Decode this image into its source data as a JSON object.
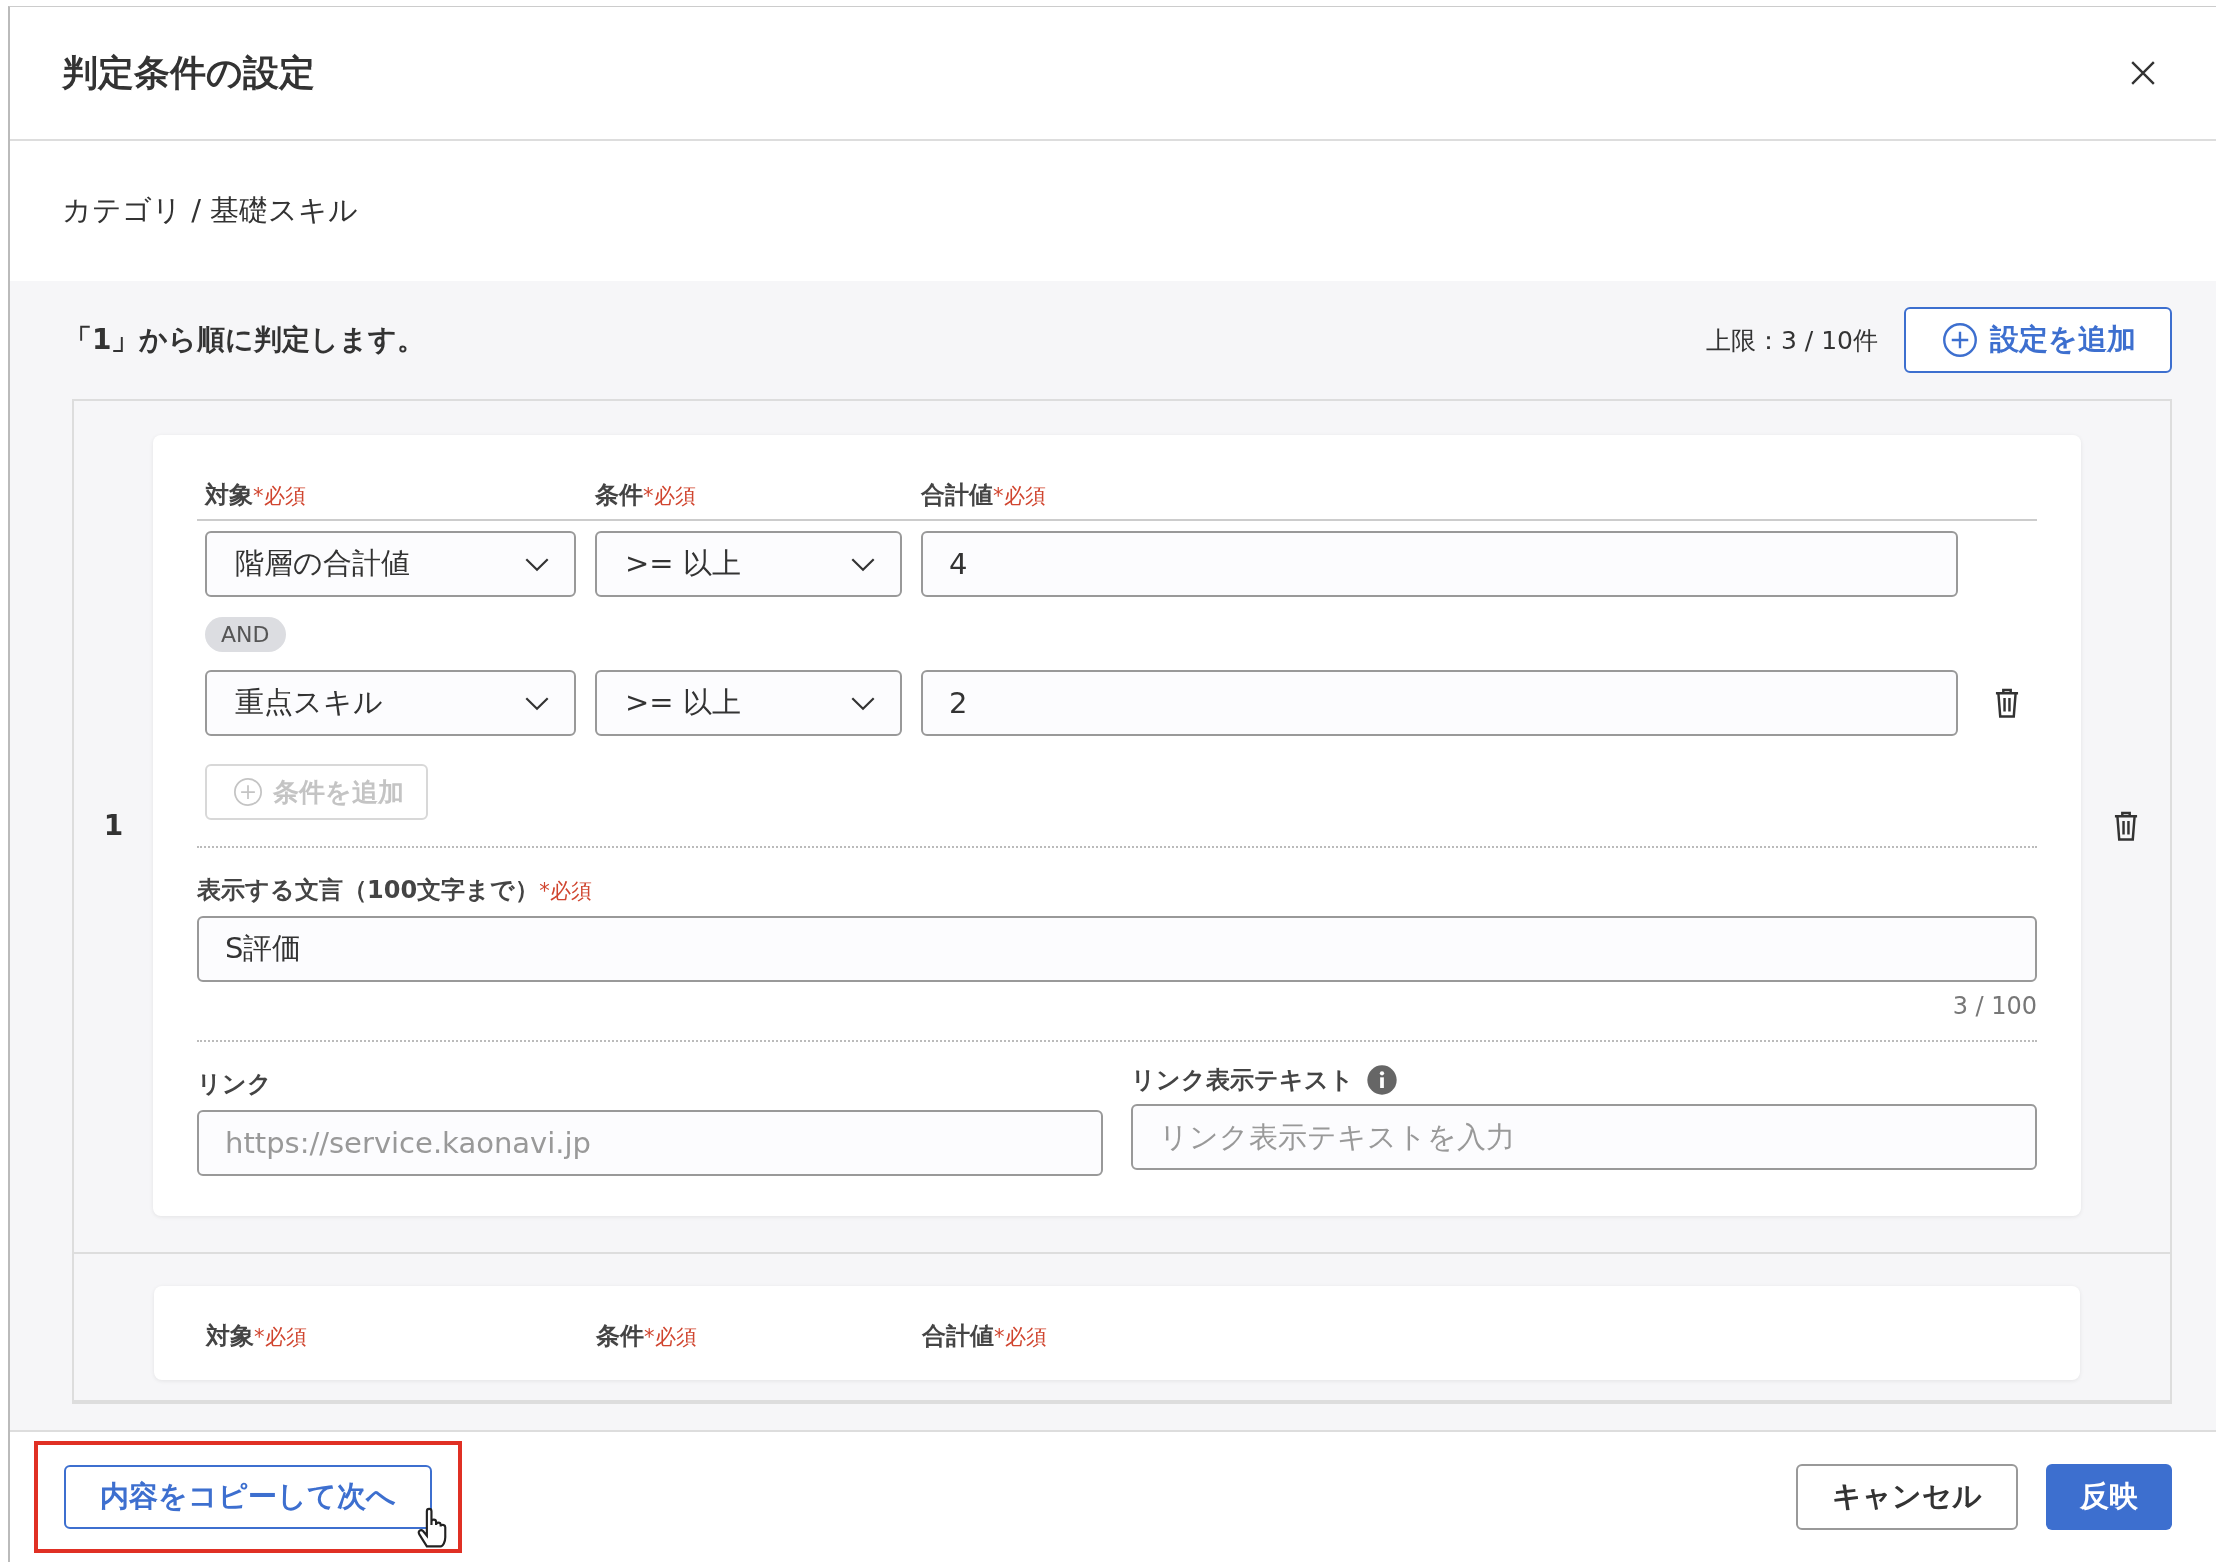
{
  "dialog": {
    "title": "判定条件の設定"
  },
  "breadcrumb": "カテゴリ / 基礎スキル",
  "intro": "「1」から順に判定します。",
  "limit": "上限：3 / 10件",
  "add_setting_button": "設定を追加",
  "settings": [
    {
      "number": "1",
      "columns": [
        {
          "label": "対象",
          "required_mark": "*",
          "required": "必須"
        },
        {
          "label": "条件",
          "required_mark": "*",
          "required": "必須"
        },
        {
          "label": "合計値",
          "required_mark": "*",
          "required": "必須"
        }
      ],
      "conditions": [
        {
          "target": "階層の合計値",
          "operator": ">= 以上",
          "value": "4",
          "deletable": false
        },
        {
          "connector": "AND",
          "target": "重点スキル",
          "operator": ">= 以上",
          "value": "2",
          "deletable": true
        }
      ],
      "add_condition_button": {
        "label": "条件を追加",
        "disabled": true
      },
      "message": {
        "label": "表示する文言（100文字まで）",
        "required_mark": "*",
        "required": "必須",
        "value": "S評価",
        "count": "3 / 100"
      },
      "link": {
        "label": "リンク",
        "placeholder": "https://service.kaonavi.jp"
      },
      "link_text": {
        "label": "リンク表示テキスト",
        "placeholder": "リンク表示テキストを入力"
      }
    },
    {
      "columns": [
        {
          "label": "対象",
          "required_mark": "*",
          "required": "必須"
        },
        {
          "label": "条件",
          "required_mark": "*",
          "required": "必須"
        },
        {
          "label": "合計値",
          "required_mark": "*",
          "required": "必須"
        }
      ]
    }
  ],
  "footer": {
    "copy_button": {
      "label": "内容をコピーして次へ",
      "highlighted": true
    },
    "cancel_button": "キャンセル",
    "apply_button": "反映"
  }
}
